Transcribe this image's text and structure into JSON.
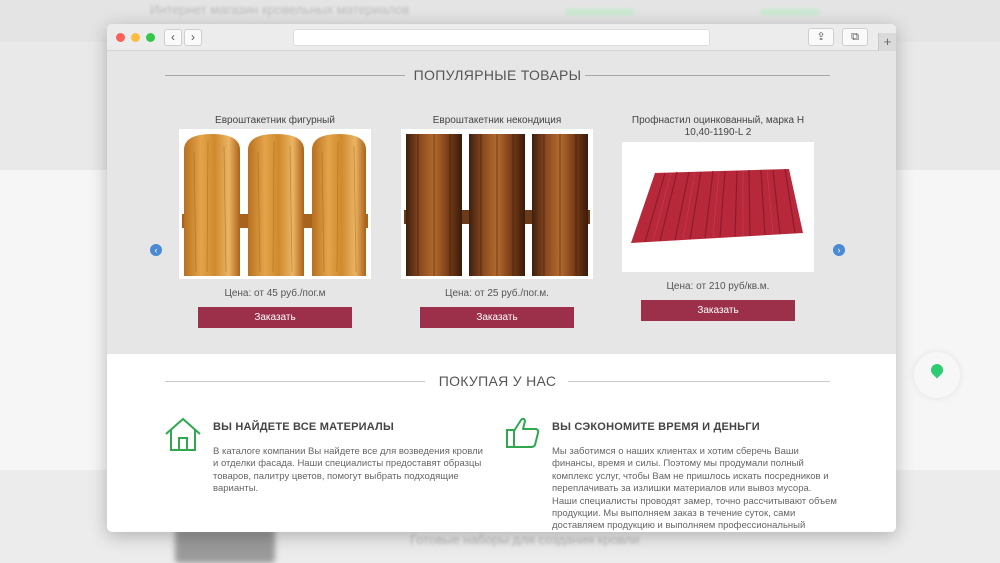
{
  "background": {
    "top_text": "Интернет магазин кровельных материалов",
    "bottom_text": "Готовые наборы для создания кровли"
  },
  "browser": {
    "back_glyph": "‹",
    "forward_glyph": "›",
    "share_glyph": "⇪",
    "tabs_glyph": "⧉",
    "new_tab_glyph": "+"
  },
  "popular": {
    "title": "ПОПУЛЯРНЫЕ ТОВАРЫ",
    "prev_glyph": "‹",
    "next_glyph": "›",
    "products": [
      {
        "name": "Евроштакетник фигурный",
        "price": "Цена: от 45 руб./пог.м",
        "button": "Заказать"
      },
      {
        "name": "Евроштакетник некондиция",
        "price": "Цена: от 25 руб./пог.м.",
        "button": "Заказать"
      },
      {
        "name": "Профнастил оцинкованный, марка Н 10,40-1190-L 2",
        "price": "Цена: от 210 руб/кв.м.",
        "button": "Заказать"
      }
    ]
  },
  "benefits": {
    "title": "ПОКУПАЯ У НАС",
    "items": [
      {
        "heading": "ВЫ НАЙДЕТЕ ВСЕ МАТЕРИАЛЫ",
        "text": "В каталоге компании Вы найдете все для возведения кровли и отделки фасада. Наши специалисты предоставят образцы товаров, палитру цветов, помогут выбрать подходящие варианты."
      },
      {
        "heading": "ВЫ СЭКОНОМИТЕ ВРЕМЯ И ДЕНЬГИ",
        "text": "Мы заботимся о наших клиентах и хотим сберечь Ваши финансы, время и силы. Поэтому мы продумали полный комплекс услуг, чтобы Вам не пришлось искать посредников и переплачивать за излишки материалов или вывоз мусора. Наши специалисты проводят замер, точно рассчитывают объем продукции. Мы выполняем заказ в течение суток, сами доставляем продукцию и выполняем профессиональный"
      }
    ]
  },
  "colors": {
    "accent_button": "#9c2f4a",
    "icon_green": "#2fa84f",
    "slider_arrow": "#4a8ad4"
  }
}
